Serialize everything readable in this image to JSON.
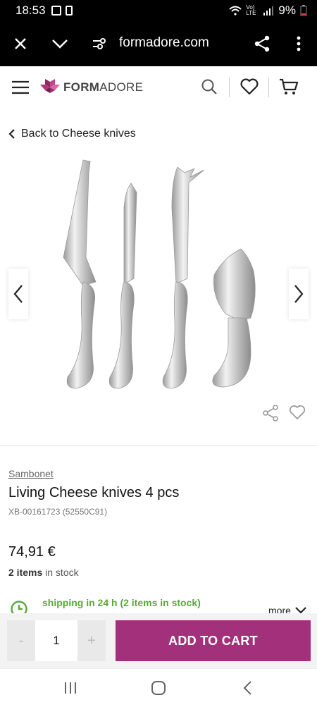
{
  "status_bar": {
    "time": "18:53",
    "battery": "9%",
    "network": "Vo) LTE"
  },
  "browser": {
    "url": "formadore.com"
  },
  "header": {
    "logo_bold": "FORM",
    "logo_light": "ADORE"
  },
  "breadcrumb": {
    "back_label": "Back to Cheese knives"
  },
  "product": {
    "brand": "Sambonet",
    "title": "Living Cheese knives 4 pcs",
    "sku": "XB-00161723 (52550C91)",
    "price": "74,91 €",
    "stock_count": "2 items",
    "stock_suffix": " in stock",
    "shipping": "shipping in 24 h (2 items in stock)",
    "more_label": "more"
  },
  "cart": {
    "minus": "-",
    "quantity": "1",
    "plus": "+",
    "add_label": "ADD TO CART"
  },
  "colors": {
    "accent": "#a2307a",
    "shipping_green": "#5aa73a",
    "logo_dark": "#8a2a63",
    "logo_light": "#c8418e"
  }
}
